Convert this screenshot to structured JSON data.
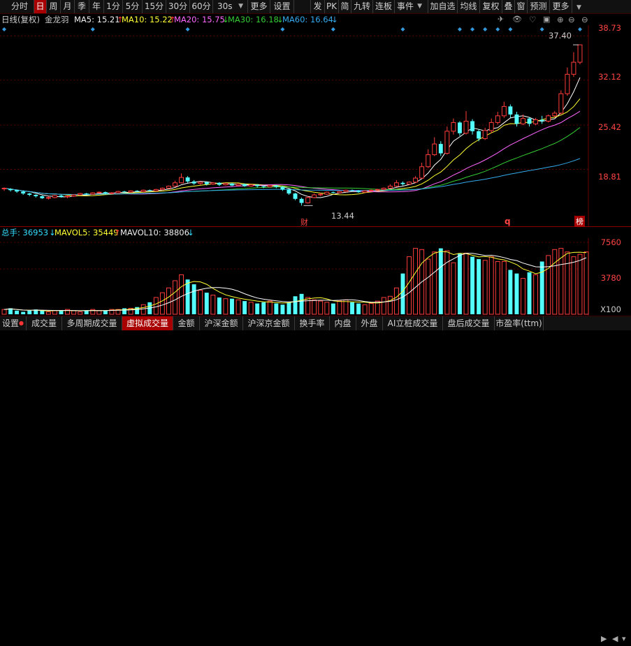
{
  "toolbar": {
    "periods": [
      "分时",
      "日",
      "周",
      "月",
      "季",
      "年",
      "1分",
      "5分",
      "15分",
      "30分",
      "60分",
      "30s",
      "更多",
      "设置"
    ],
    "active_period": "日",
    "right_buttons": [
      "发",
      "PK",
      "简",
      "九转",
      "连板",
      "事件",
      "加自选",
      "均线",
      "复权",
      "叠",
      "窗",
      "预测",
      "更多"
    ]
  },
  "info": {
    "chart_type": "日线(复权)",
    "stock_name": "金龙羽",
    "ma5": "MA5: 15.21",
    "ma10": "MA10: 15.22",
    "ma20": "MA20: 15.75",
    "ma30": "MA30: 16.18",
    "ma60": "MA60: 16.64",
    "colors": {
      "ma5": "#ffffff",
      "ma10": "#ffff33",
      "ma20": "#ff66ff",
      "ma30": "#33cc33",
      "ma60": "#33aaee"
    }
  },
  "price_axis": {
    "labels": [
      "38.73",
      "32.12",
      "25.42",
      "18.81"
    ]
  },
  "annotations": {
    "high_label": "37.40",
    "low_label": "13.44",
    "markers": [
      "财",
      "q",
      "榜"
    ]
  },
  "volume": {
    "total_label": "总手: 36953",
    "mavol5": "MAVOL5: 35449",
    "mavol10": "MAVOL10: 38806",
    "axis_labels": [
      "7560",
      "3780",
      "X100"
    ]
  },
  "bottom_tabs": [
    "设置",
    "成交量",
    "多周期成交量",
    "虚拟成交量",
    "金额",
    "沪深金额",
    "沪深京金额",
    "换手率",
    "内盘",
    "外盘",
    "AI立桩成交量",
    "盘后成交量",
    "市盈率(ttm)"
  ],
  "active_tab": "虚拟成交量",
  "chart_data": {
    "type": "candlestick",
    "ylim": [
      12.5,
      39.5
    ],
    "candles": [
      [
        15.9,
        16.0,
        15.6,
        16.1
      ],
      [
        15.9,
        15.7,
        15.5,
        16.0
      ],
      [
        15.7,
        15.5,
        15.3,
        15.8
      ],
      [
        15.5,
        15.2,
        15.0,
        15.6
      ],
      [
        15.2,
        15.0,
        14.8,
        15.3
      ],
      [
        15.0,
        14.8,
        14.6,
        15.1
      ],
      [
        14.8,
        14.5,
        14.4,
        14.9
      ],
      [
        14.5,
        14.6,
        14.3,
        14.8
      ],
      [
        14.6,
        14.9,
        14.5,
        15.0
      ],
      [
        14.9,
        14.7,
        14.6,
        15.0
      ],
      [
        14.7,
        14.8,
        14.5,
        14.9
      ],
      [
        14.8,
        15.0,
        14.7,
        15.1
      ],
      [
        15.0,
        15.2,
        14.9,
        15.3
      ],
      [
        15.2,
        15.1,
        15.0,
        15.3
      ],
      [
        15.1,
        15.3,
        15.0,
        15.4
      ],
      [
        15.3,
        15.4,
        15.2,
        15.5
      ],
      [
        15.4,
        15.2,
        15.1,
        15.5
      ],
      [
        15.2,
        15.3,
        15.1,
        15.4
      ],
      [
        15.3,
        15.5,
        15.2,
        15.6
      ],
      [
        15.5,
        15.4,
        15.3,
        15.6
      ],
      [
        15.4,
        15.6,
        15.3,
        15.7
      ],
      [
        15.6,
        15.5,
        15.4,
        15.7
      ],
      [
        15.5,
        15.7,
        15.4,
        15.8
      ],
      [
        15.7,
        15.6,
        15.5,
        15.8
      ],
      [
        15.6,
        15.8,
        15.5,
        15.9
      ],
      [
        15.8,
        16.0,
        15.7,
        16.1
      ],
      [
        16.0,
        16.3,
        15.9,
        16.4
      ],
      [
        16.3,
        16.8,
        16.2,
        17.1
      ],
      [
        16.8,
        17.6,
        16.7,
        18.2
      ],
      [
        17.6,
        17.0,
        16.8,
        17.8
      ],
      [
        17.0,
        16.7,
        16.5,
        17.2
      ],
      [
        16.7,
        16.9,
        16.5,
        17.0
      ],
      [
        16.9,
        16.6,
        16.4,
        17.0
      ],
      [
        16.6,
        16.8,
        16.5,
        16.9
      ],
      [
        16.8,
        16.5,
        16.3,
        16.9
      ],
      [
        16.5,
        16.7,
        16.4,
        16.8
      ],
      [
        16.7,
        16.4,
        16.3,
        16.8
      ],
      [
        16.4,
        16.6,
        16.3,
        16.7
      ],
      [
        16.6,
        16.3,
        16.2,
        16.7
      ],
      [
        16.3,
        16.5,
        16.2,
        16.6
      ],
      [
        16.5,
        16.3,
        16.1,
        16.6
      ],
      [
        16.3,
        16.2,
        16.0,
        16.4
      ],
      [
        16.2,
        16.4,
        16.1,
        16.5
      ],
      [
        16.4,
        16.2,
        16.0,
        16.5
      ],
      [
        16.2,
        15.8,
        15.6,
        16.3
      ],
      [
        15.8,
        15.2,
        15.0,
        15.9
      ],
      [
        15.2,
        14.4,
        14.2,
        15.3
      ],
      [
        14.4,
        13.8,
        13.4,
        14.6
      ],
      [
        13.8,
        14.6,
        13.7,
        14.8
      ],
      [
        14.6,
        15.0,
        14.5,
        15.2
      ],
      [
        15.0,
        15.1,
        14.8,
        15.3
      ],
      [
        15.1,
        15.4,
        15.0,
        15.5
      ],
      [
        15.4,
        15.3,
        15.2,
        15.5
      ],
      [
        15.3,
        15.5,
        15.2,
        15.6
      ],
      [
        15.5,
        15.7,
        15.4,
        15.8
      ],
      [
        15.7,
        15.6,
        15.5,
        15.8
      ],
      [
        15.6,
        15.4,
        15.3,
        15.7
      ],
      [
        15.4,
        15.6,
        15.3,
        15.7
      ],
      [
        15.6,
        15.7,
        15.5,
        15.8
      ],
      [
        15.7,
        15.8,
        15.6,
        15.9
      ],
      [
        15.8,
        16.0,
        15.7,
        16.1
      ],
      [
        16.0,
        16.3,
        15.9,
        16.6
      ],
      [
        16.3,
        16.8,
        16.2,
        17.2
      ],
      [
        16.8,
        16.6,
        16.4,
        17.0
      ],
      [
        16.6,
        16.9,
        16.5,
        17.0
      ],
      [
        16.9,
        17.5,
        16.8,
        17.8
      ],
      [
        17.5,
        19.2,
        17.4,
        19.8
      ],
      [
        19.2,
        21.0,
        19.0,
        21.8
      ],
      [
        21.0,
        22.6,
        20.8,
        23.6
      ],
      [
        22.6,
        21.2,
        20.8,
        23.0
      ],
      [
        21.2,
        24.5,
        21.0,
        25.2
      ],
      [
        24.5,
        25.8,
        24.0,
        26.4
      ],
      [
        25.8,
        24.2,
        23.8,
        26.0
      ],
      [
        24.2,
        26.0,
        24.0,
        27.5
      ],
      [
        26.0,
        24.5,
        24.0,
        26.3
      ],
      [
        24.5,
        23.4,
        23.0,
        24.8
      ],
      [
        23.4,
        24.6,
        23.2,
        25.0
      ],
      [
        24.6,
        25.8,
        24.2,
        26.4
      ],
      [
        25.8,
        26.8,
        25.5,
        27.4
      ],
      [
        26.8,
        28.2,
        26.5,
        28.9
      ],
      [
        28.2,
        27.0,
        26.5,
        28.5
      ],
      [
        27.0,
        25.6,
        25.2,
        27.4
      ],
      [
        25.6,
        26.4,
        25.4,
        27.0
      ],
      [
        26.4,
        25.6,
        25.2,
        26.6
      ],
      [
        25.6,
        26.2,
        25.4,
        26.5
      ],
      [
        26.2,
        26.0,
        25.6,
        26.8
      ],
      [
        26.0,
        26.8,
        25.8,
        27.0
      ],
      [
        26.8,
        27.2,
        26.6,
        27.5
      ],
      [
        27.2,
        30.1,
        27.0,
        30.6
      ],
      [
        30.1,
        33.0,
        29.8,
        34.0
      ],
      [
        33.0,
        34.8,
        32.6,
        36.3
      ],
      [
        34.8,
        37.4,
        34.5,
        37.4
      ]
    ],
    "volumes": [
      4,
      5,
      3,
      2,
      3,
      4,
      3,
      2,
      3,
      3,
      4,
      3,
      2,
      3,
      4,
      3,
      3,
      4,
      4,
      5,
      5,
      6,
      8,
      10,
      14,
      18,
      22,
      28,
      33,
      29,
      25,
      20,
      18,
      16,
      14,
      13,
      13,
      12,
      11,
      10,
      9,
      10,
      11,
      9,
      8,
      10,
      15,
      17,
      14,
      12,
      11,
      10,
      9,
      11,
      12,
      10,
      9,
      8,
      9,
      11,
      14,
      15,
      22,
      34,
      48,
      55,
      54,
      46,
      52,
      55,
      53,
      43,
      51,
      51,
      48,
      46,
      45,
      48,
      44,
      44,
      37,
      34,
      30,
      35,
      33,
      44,
      49,
      54,
      55,
      52,
      48,
      50,
      52
    ]
  }
}
